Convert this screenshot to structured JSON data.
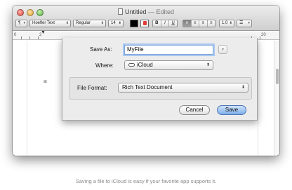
{
  "window": {
    "title": "Untitled",
    "title_separator": "—",
    "title_status": "Edited"
  },
  "toolbar": {
    "style_popup": "¶",
    "font_family": "Hoefler Text",
    "font_style": "Regular",
    "font_size": "14",
    "bold": "B",
    "italic": "I",
    "underline": "U",
    "line_spacing": "1.0",
    "list_style": "☰",
    "text_color": "#000000",
    "highlight_color": "#e23b3b"
  },
  "ruler": {
    "labels": [
      "0",
      "2",
      "20"
    ]
  },
  "document": {
    "visible_text": "st"
  },
  "save_sheet": {
    "save_as_label": "Save As:",
    "filename_value": "MyFile",
    "where_label": "Where:",
    "where_value": "iCloud",
    "file_format_label": "File Format:",
    "file_format_value": "Rich Text Document",
    "cancel_label": "Cancel",
    "save_label": "Save"
  },
  "caption": "Saving a file to iCloud is easy if your favorite app supports it."
}
